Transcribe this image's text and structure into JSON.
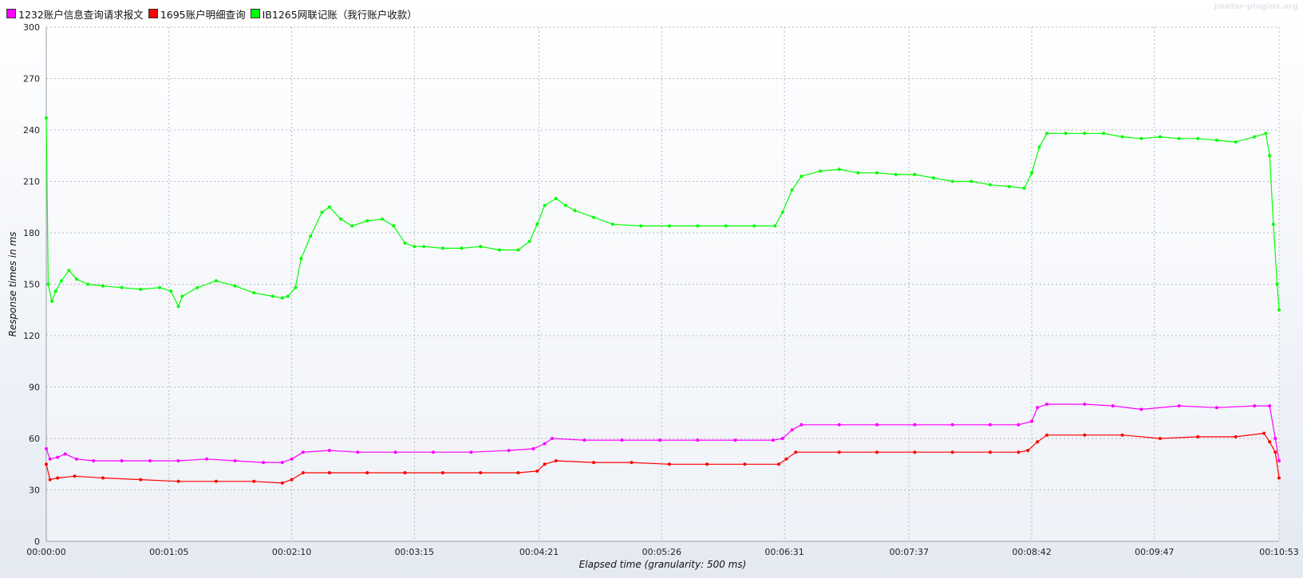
{
  "watermark": "jmeter-plugins.org",
  "chart_data": {
    "type": "line",
    "title": "",
    "xlabel": "Elapsed time (granularity: 500 ms)",
    "ylabel": "Response times in ms",
    "xlim": [
      0,
      653
    ],
    "ylim": [
      0,
      300
    ],
    "y_ticks": [
      0,
      30,
      60,
      90,
      120,
      150,
      180,
      210,
      240,
      270,
      300
    ],
    "x_ticks": [
      {
        "t": 0,
        "label": "00:00:00"
      },
      {
        "t": 65,
        "label": "00:01:05"
      },
      {
        "t": 130,
        "label": "00:02:10"
      },
      {
        "t": 195,
        "label": "00:03:15"
      },
      {
        "t": 261,
        "label": "00:04:21"
      },
      {
        "t": 326,
        "label": "00:05:26"
      },
      {
        "t": 391,
        "label": "00:06:31"
      },
      {
        "t": 457,
        "label": "00:07:37"
      },
      {
        "t": 522,
        "label": "00:08:42"
      },
      {
        "t": 587,
        "label": "00:09:47"
      },
      {
        "t": 653,
        "label": "00:10:53"
      }
    ],
    "grid": true,
    "legend_position": "top-left",
    "series": [
      {
        "name": "1232账户信息查询请求报文",
        "color": "#ff00ff",
        "points": [
          [
            0,
            54
          ],
          [
            2,
            48
          ],
          [
            6,
            49
          ],
          [
            10,
            51
          ],
          [
            16,
            48
          ],
          [
            25,
            47
          ],
          [
            40,
            47
          ],
          [
            55,
            47
          ],
          [
            70,
            47
          ],
          [
            85,
            48
          ],
          [
            100,
            47
          ],
          [
            115,
            46
          ],
          [
            125,
            46
          ],
          [
            130,
            48
          ],
          [
            136,
            52
          ],
          [
            150,
            53
          ],
          [
            165,
            52
          ],
          [
            185,
            52
          ],
          [
            205,
            52
          ],
          [
            225,
            52
          ],
          [
            245,
            53
          ],
          [
            258,
            54
          ],
          [
            264,
            57
          ],
          [
            268,
            60
          ],
          [
            285,
            59
          ],
          [
            305,
            59
          ],
          [
            325,
            59
          ],
          [
            345,
            59
          ],
          [
            365,
            59
          ],
          [
            385,
            59
          ],
          [
            390,
            60
          ],
          [
            395,
            65
          ],
          [
            400,
            68
          ],
          [
            420,
            68
          ],
          [
            440,
            68
          ],
          [
            460,
            68
          ],
          [
            480,
            68
          ],
          [
            500,
            68
          ],
          [
            515,
            68
          ],
          [
            522,
            70
          ],
          [
            525,
            78
          ],
          [
            530,
            80
          ],
          [
            550,
            80
          ],
          [
            565,
            79
          ],
          [
            580,
            77
          ],
          [
            600,
            79
          ],
          [
            620,
            78
          ],
          [
            640,
            79
          ],
          [
            648,
            79
          ],
          [
            651,
            60
          ],
          [
            653,
            47
          ]
        ]
      },
      {
        "name": "1695账户明细查询",
        "color": "#ff0000",
        "points": [
          [
            0,
            45
          ],
          [
            2,
            36
          ],
          [
            6,
            37
          ],
          [
            15,
            38
          ],
          [
            30,
            37
          ],
          [
            50,
            36
          ],
          [
            70,
            35
          ],
          [
            90,
            35
          ],
          [
            110,
            35
          ],
          [
            125,
            34
          ],
          [
            130,
            36
          ],
          [
            136,
            40
          ],
          [
            150,
            40
          ],
          [
            170,
            40
          ],
          [
            190,
            40
          ],
          [
            210,
            40
          ],
          [
            230,
            40
          ],
          [
            250,
            40
          ],
          [
            260,
            41
          ],
          [
            264,
            45
          ],
          [
            270,
            47
          ],
          [
            290,
            46
          ],
          [
            310,
            46
          ],
          [
            330,
            45
          ],
          [
            350,
            45
          ],
          [
            370,
            45
          ],
          [
            388,
            45
          ],
          [
            392,
            48
          ],
          [
            397,
            52
          ],
          [
            420,
            52
          ],
          [
            440,
            52
          ],
          [
            460,
            52
          ],
          [
            480,
            52
          ],
          [
            500,
            52
          ],
          [
            515,
            52
          ],
          [
            520,
            53
          ],
          [
            525,
            58
          ],
          [
            530,
            62
          ],
          [
            550,
            62
          ],
          [
            570,
            62
          ],
          [
            590,
            60
          ],
          [
            610,
            61
          ],
          [
            630,
            61
          ],
          [
            645,
            63
          ],
          [
            648,
            58
          ],
          [
            651,
            52
          ],
          [
            653,
            37
          ]
        ]
      },
      {
        "name": "IB1265网联记账（我行账户收款）",
        "color": "#00ff00",
        "points": [
          [
            0,
            247
          ],
          [
            1,
            150
          ],
          [
            3,
            140
          ],
          [
            5,
            146
          ],
          [
            8,
            152
          ],
          [
            12,
            158
          ],
          [
            16,
            153
          ],
          [
            22,
            150
          ],
          [
            30,
            149
          ],
          [
            40,
            148
          ],
          [
            50,
            147
          ],
          [
            60,
            148
          ],
          [
            66,
            146
          ],
          [
            70,
            137
          ],
          [
            72,
            143
          ],
          [
            80,
            148
          ],
          [
            90,
            152
          ],
          [
            100,
            149
          ],
          [
            110,
            145
          ],
          [
            120,
            143
          ],
          [
            125,
            142
          ],
          [
            128,
            143
          ],
          [
            132,
            148
          ],
          [
            135,
            165
          ],
          [
            140,
            178
          ],
          [
            146,
            192
          ],
          [
            150,
            195
          ],
          [
            156,
            188
          ],
          [
            162,
            184
          ],
          [
            170,
            187
          ],
          [
            178,
            188
          ],
          [
            184,
            184
          ],
          [
            190,
            174
          ],
          [
            195,
            172
          ],
          [
            200,
            172
          ],
          [
            210,
            171
          ],
          [
            220,
            171
          ],
          [
            230,
            172
          ],
          [
            240,
            170
          ],
          [
            250,
            170
          ],
          [
            256,
            175
          ],
          [
            260,
            185
          ],
          [
            264,
            196
          ],
          [
            270,
            200
          ],
          [
            275,
            196
          ],
          [
            280,
            193
          ],
          [
            290,
            189
          ],
          [
            300,
            185
          ],
          [
            315,
            184
          ],
          [
            330,
            184
          ],
          [
            345,
            184
          ],
          [
            360,
            184
          ],
          [
            375,
            184
          ],
          [
            386,
            184
          ],
          [
            390,
            192
          ],
          [
            395,
            205
          ],
          [
            400,
            213
          ],
          [
            410,
            216
          ],
          [
            420,
            217
          ],
          [
            430,
            215
          ],
          [
            440,
            215
          ],
          [
            450,
            214
          ],
          [
            460,
            214
          ],
          [
            470,
            212
          ],
          [
            480,
            210
          ],
          [
            490,
            210
          ],
          [
            500,
            208
          ],
          [
            510,
            207
          ],
          [
            518,
            206
          ],
          [
            522,
            215
          ],
          [
            526,
            230
          ],
          [
            530,
            238
          ],
          [
            540,
            238
          ],
          [
            550,
            238
          ],
          [
            560,
            238
          ],
          [
            570,
            236
          ],
          [
            580,
            235
          ],
          [
            590,
            236
          ],
          [
            600,
            235
          ],
          [
            610,
            235
          ],
          [
            620,
            234
          ],
          [
            630,
            233
          ],
          [
            640,
            236
          ],
          [
            646,
            238
          ],
          [
            648,
            225
          ],
          [
            650,
            185
          ],
          [
            652,
            150
          ],
          [
            653,
            135
          ]
        ]
      }
    ]
  }
}
